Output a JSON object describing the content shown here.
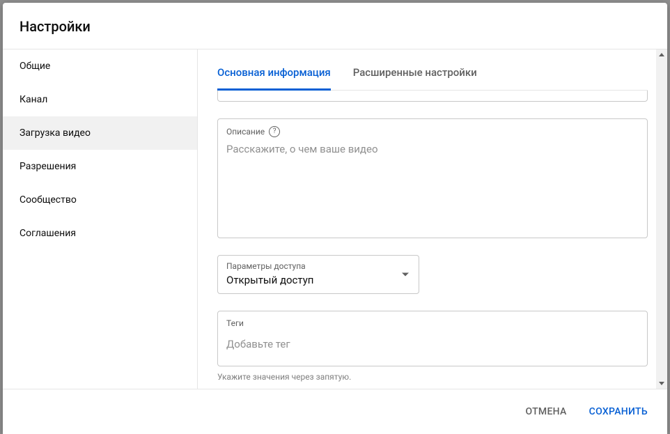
{
  "modal": {
    "title": "Настройки"
  },
  "sidebar": {
    "items": [
      {
        "label": "Общие"
      },
      {
        "label": "Канал"
      },
      {
        "label": "Загрузка видео"
      },
      {
        "label": "Разрешения"
      },
      {
        "label": "Сообщество"
      },
      {
        "label": "Соглашения"
      }
    ],
    "active_index": 2
  },
  "tabs": {
    "items": [
      {
        "label": "Основная информация"
      },
      {
        "label": "Расширенные настройки"
      }
    ],
    "active_index": 0
  },
  "fields": {
    "description": {
      "label": "Описание",
      "placeholder": "Расскажите, о чем ваше видео",
      "value": ""
    },
    "visibility": {
      "label": "Параметры доступа",
      "value": "Открытый доступ"
    },
    "tags": {
      "label": "Теги",
      "placeholder": "Добавьте тег",
      "value": "",
      "helper": "Укажите значения через запятую."
    }
  },
  "footer": {
    "cancel": "ОТМЕНА",
    "save": "СОХРАНИТЬ"
  },
  "icons": {
    "help": "?"
  }
}
